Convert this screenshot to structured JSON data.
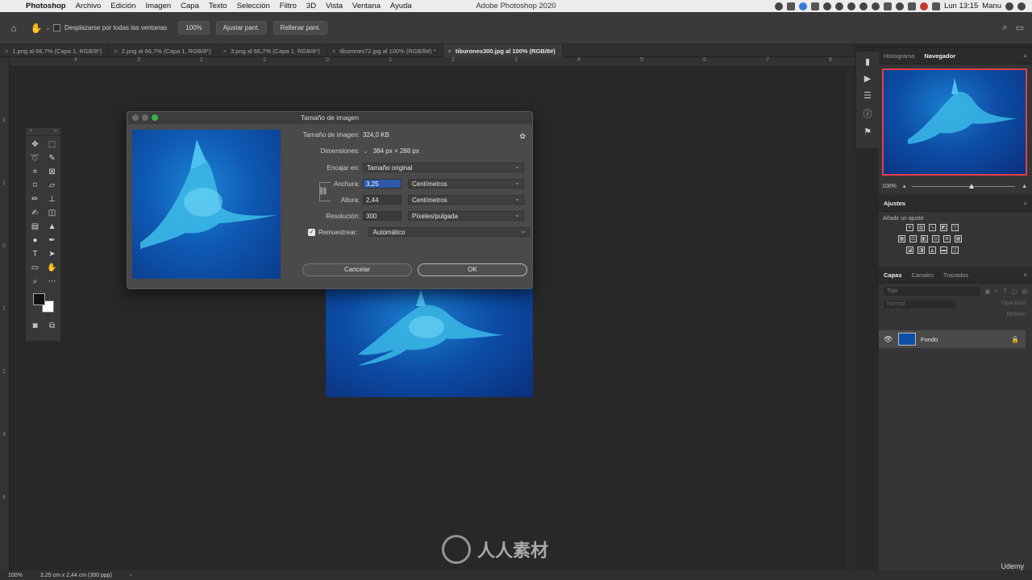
{
  "menubar": {
    "app_name": "Photoshop",
    "items": [
      "Archivo",
      "Edición",
      "Imagen",
      "Capa",
      "Texto",
      "Selección",
      "Filtro",
      "3D",
      "Vista",
      "Ventana",
      "Ayuda"
    ],
    "window_title": "Adobe Photoshop 2020",
    "clock": "Lun 13:15",
    "user": "Manu"
  },
  "options_bar": {
    "scroll_all_label": "Desplazarse por todas las ventanas",
    "zoom_100": "100%",
    "fit_screen": "Ajustar pant.",
    "fill_screen": "Rellenar pant."
  },
  "tabs": [
    {
      "label": "1.png al 66,7% (Capa 1, RGB/8*)",
      "active": false
    },
    {
      "label": "2.png al 66,7% (Capa 1, RGB/8*)",
      "active": false
    },
    {
      "label": "3.png al 66,7% (Capa 1, RGB/8*)",
      "active": false
    },
    {
      "label": "tiburones72.jpg al 100% (RGB/8#) *",
      "active": false
    },
    {
      "label": "tiburones300.jpg al 100% (RGB/8#)",
      "active": true
    }
  ],
  "rulers": {
    "h_ticks": [
      "4",
      "3",
      "2",
      "1",
      "0",
      "1",
      "2",
      "3",
      "4",
      "5",
      "6",
      "7",
      "8"
    ],
    "v_ticks": [
      "2",
      "1",
      "0",
      "1",
      "2",
      "3",
      "4"
    ]
  },
  "dialog": {
    "title": "Tamaño de imagen",
    "image_size_label": "Tamaño de imagen:",
    "image_size_value": "324,0 KB",
    "dimensions_label": "Dimensiones:",
    "dimensions_value": "384 px × 288 px",
    "fit_label": "Encajar en:",
    "fit_value": "Tamaño original",
    "width_label": "Anchura:",
    "width_value": "3,25",
    "width_unit": "Centímetros",
    "height_label": "Altura:",
    "height_value": "2,44",
    "height_unit": "Centímetros",
    "resolution_label": "Resolución:",
    "resolution_value": "300",
    "resolution_unit": "Píxeles/pulgada",
    "resample_label": "Remuestrear:",
    "resample_value": "Automático",
    "cancel": "Cancelar",
    "ok": "OK"
  },
  "panels": {
    "nav_tabs": [
      "Histograma",
      "Navegador"
    ],
    "nav_zoom": "100%",
    "adjust_title": "Ajustes",
    "adjust_sub": "Añadir un ajuste",
    "layer_tabs": [
      "Capas",
      "Canales",
      "Trazados"
    ],
    "layer_filter": "Tipo",
    "blend_mode": "Normal",
    "opacity_label": "Opacidad:",
    "fill_label": "Relleno:",
    "layer_name": "Fondo"
  },
  "status_bar": {
    "zoom": "100%",
    "doc_info": "3,25 cm x 2,44 cm (300 ppp)"
  },
  "watermark": {
    "brand": "人人素材",
    "udemy": "Udemy"
  }
}
